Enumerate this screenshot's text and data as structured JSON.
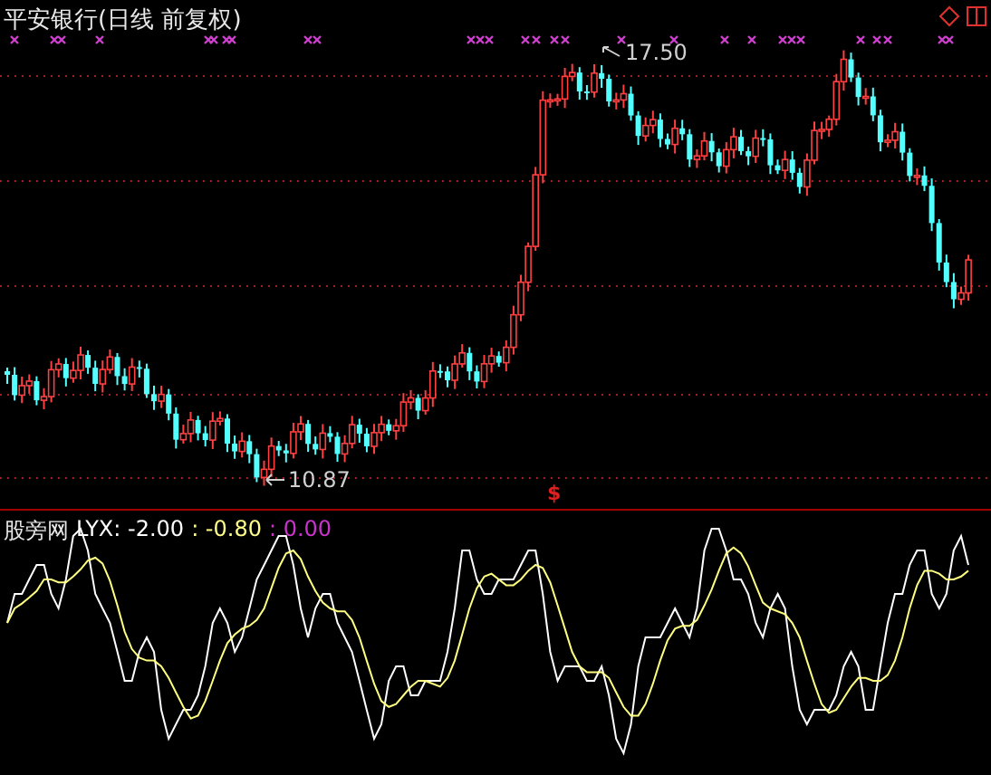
{
  "title": "平安银行(日线 前复权)",
  "toolbar": [
    {
      "kind": "diamond"
    },
    {
      "kind": "square"
    }
  ],
  "price_annotations": [
    {
      "kind": "high",
      "label": "17.50"
    },
    {
      "kind": "low",
      "label": "10.87"
    }
  ],
  "signal_marker": "$",
  "indicator": {
    "name": "股旁网",
    "values": [
      {
        "text": "LYX: -2.00",
        "color": "#ffffff"
      },
      {
        "text": ": -0.80",
        "color": "#ffff88"
      },
      {
        "text": ": 0.00",
        "color": "#cc33cc"
      }
    ]
  }
}
